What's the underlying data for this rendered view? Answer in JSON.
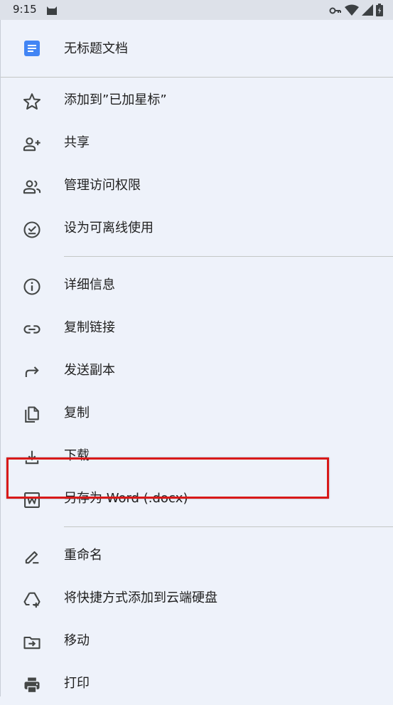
{
  "status_bar": {
    "time": "9:15",
    "left_icon": "cat-icon",
    "right_icons": [
      "key-icon",
      "wifi-icon",
      "signal-icon",
      "battery-icon"
    ]
  },
  "document": {
    "title": "无标题文档",
    "icon": "google-docs-icon",
    "icon_color": "#4285f4"
  },
  "menu": {
    "items": [
      {
        "label": "添加到”已加星标”",
        "icon": "star-outline-icon"
      },
      {
        "label": "共享",
        "icon": "person-add-icon"
      },
      {
        "label": "管理访问权限",
        "icon": "people-icon"
      },
      {
        "label": "设为可离线使用",
        "icon": "offline-check-icon"
      },
      {
        "label": "详细信息",
        "icon": "info-icon"
      },
      {
        "label": "复制链接",
        "icon": "link-icon"
      },
      {
        "label": "发送副本",
        "icon": "forward-arrow-icon"
      },
      {
        "label": "复制",
        "icon": "copy-document-icon"
      },
      {
        "label": "下载",
        "icon": "download-icon"
      },
      {
        "label": "另存为 Word (.docx)",
        "icon": "word-icon"
      },
      {
        "label": "重命名",
        "icon": "pencil-rename-icon"
      },
      {
        "label": "将快捷方式添加到云端硬盘",
        "icon": "drive-shortcut-icon"
      },
      {
        "label": "移动",
        "icon": "move-folder-icon"
      },
      {
        "label": "打印",
        "icon": "print-icon"
      }
    ]
  },
  "colors": {
    "background": "#eef2fa",
    "status_bar": "#dde1e9",
    "icon": "#444746",
    "highlight": "#d81919"
  }
}
